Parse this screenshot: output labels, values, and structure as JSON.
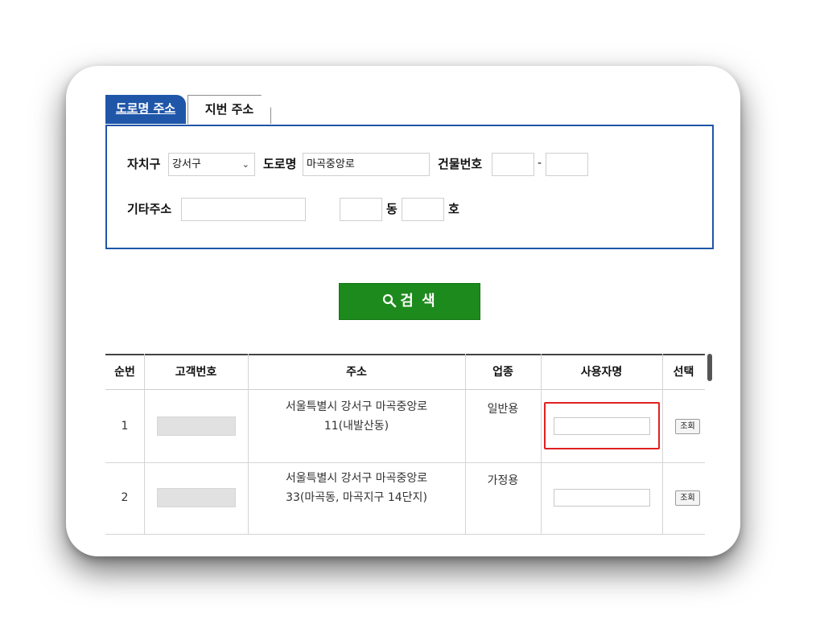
{
  "tabs": {
    "road_label": "도로명 주소",
    "lot_label": "지번 주소"
  },
  "form": {
    "district_label": "자치구",
    "district_value": "강서구",
    "road_label": "도로명",
    "road_value": "마곡중앙로",
    "building_label": "건물번호",
    "building_main": "",
    "building_sub": "",
    "building_dash": "-",
    "etc_label": "기타주소",
    "etc_value": "",
    "dong_value": "",
    "dong_label": "동",
    "ho_value": "",
    "ho_label": "호"
  },
  "search_button": {
    "label": "검 색",
    "icon": "search-icon"
  },
  "table": {
    "headers": [
      "순번",
      "고객번호",
      "주소",
      "업종",
      "사용자명",
      "선택"
    ],
    "rows": [
      {
        "no": "1",
        "address_line1": "서울특별시 강서구  마곡중앙로",
        "address_line2": "11(내발산동)",
        "type": "일반용",
        "select_label": "조회"
      },
      {
        "no": "2",
        "address_line1": "서울특별시 강서구  마곡중앙로",
        "address_line2": "33(마곡동, 마곡지구 14단지)",
        "type": "가정용",
        "select_label": "조회"
      }
    ]
  },
  "colors": {
    "tab_active": "#1f56a8",
    "search_button": "#1c8a1c",
    "highlight": "#e02020"
  }
}
